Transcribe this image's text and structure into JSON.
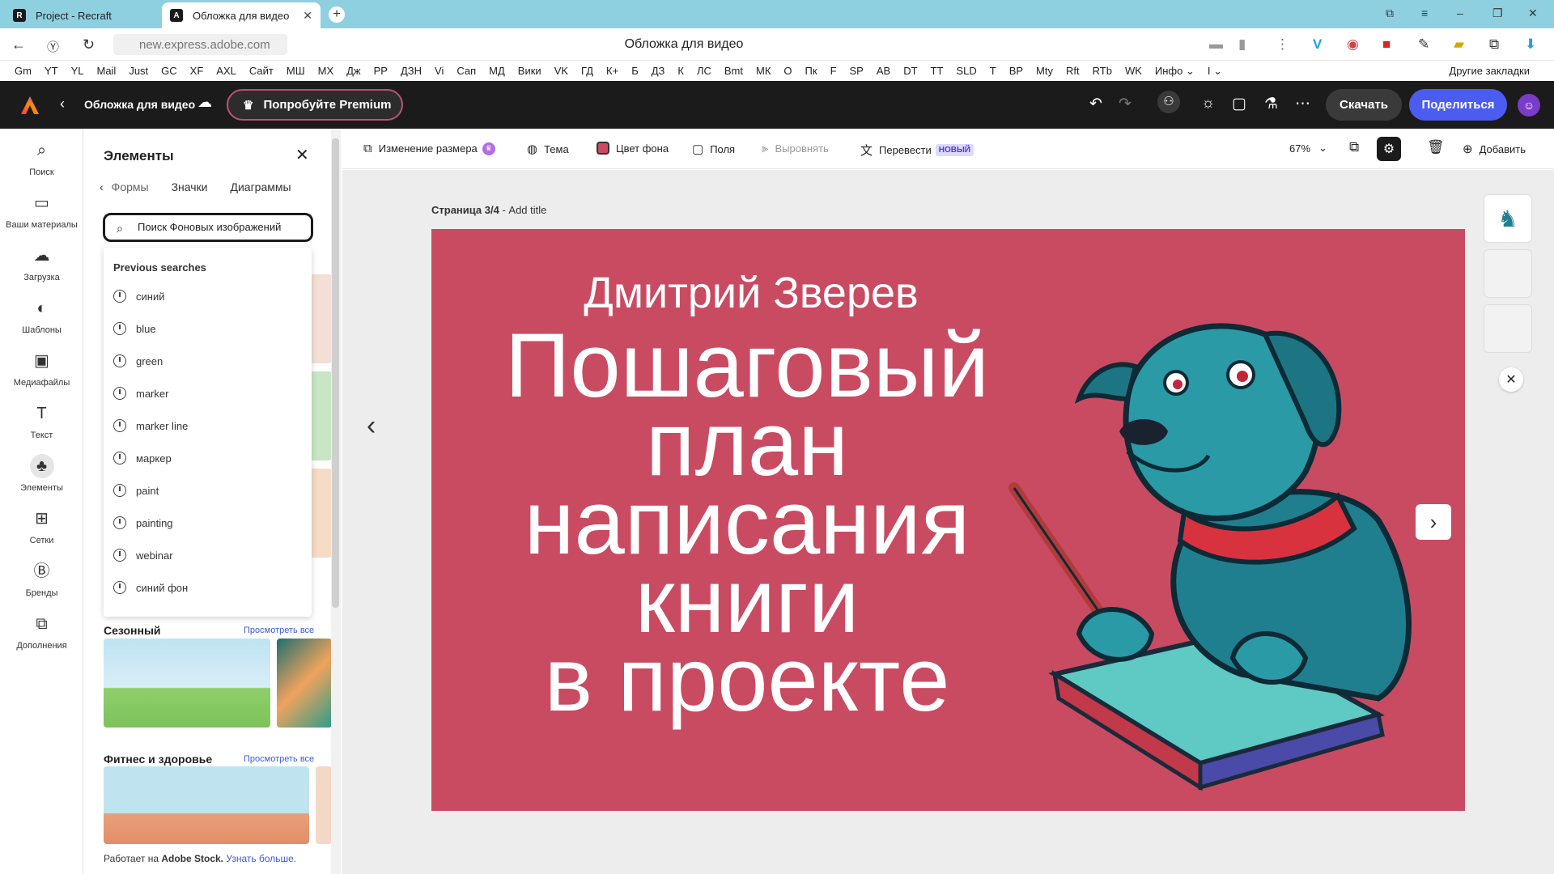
{
  "browser": {
    "tabs": [
      {
        "label": "Project - Recraft",
        "favicon": "R"
      },
      {
        "label": "Обложка для видео",
        "favicon": "A"
      }
    ],
    "url": "new.express.adobe.com",
    "page_title": "Обложка для видео",
    "bookmarks": [
      "Gm",
      "YT",
      "YL",
      "Mail",
      "Just",
      "GC",
      "XF",
      "AXL",
      "Сайт",
      "МШ",
      "МХ",
      "Дж",
      "РР",
      "ДЗН",
      "Vi",
      "Сап",
      "МД",
      "Вики",
      "VK",
      "ГД",
      "К+",
      "Б",
      "ДЗ",
      "К",
      "ЛС",
      "Bmt",
      "МК",
      "О",
      "Пк",
      "F",
      "SP",
      "АВ",
      "DT",
      "TT",
      "SLD",
      "T",
      "BP",
      "Mty",
      "Rft",
      "RTb",
      "WK",
      "Инфо ⌄",
      "I ⌄"
    ],
    "other_bookmarks": "Другие закладки"
  },
  "app": {
    "doc_title": "Обложка для видео",
    "premium_label": "Попробуйте Premium",
    "download_label": "Скачать",
    "share_label": "Поделиться"
  },
  "rail": [
    {
      "label": "Поиск",
      "icon": "search-icon",
      "glyph": "⌕"
    },
    {
      "label": "Ваши материалы",
      "icon": "folder-icon",
      "glyph": "▭"
    },
    {
      "label": "Загрузка",
      "icon": "upload-cloud-icon",
      "glyph": "☁"
    },
    {
      "label": "Шаблоны",
      "icon": "templates-icon",
      "glyph": "◐"
    },
    {
      "label": "Медиафайлы",
      "icon": "media-icon",
      "glyph": "▣"
    },
    {
      "label": "Текст",
      "icon": "text-icon",
      "glyph": "T"
    },
    {
      "label": "Элементы",
      "icon": "elements-icon",
      "glyph": "♣"
    },
    {
      "label": "Сетки",
      "icon": "grid-icon",
      "glyph": "⊞"
    },
    {
      "label": "Бренды",
      "icon": "brand-icon",
      "glyph": "Ⓑ"
    },
    {
      "label": "Дополнения",
      "icon": "addons-icon",
      "glyph": "⧉"
    }
  ],
  "panel": {
    "title": "Элементы",
    "tabs": [
      "Формы",
      "Значки",
      "Диаграммы"
    ],
    "search_value": "Поиск Фоновых изображений",
    "previous_searches_label": "Previous searches",
    "previous_searches": [
      "синий",
      "blue",
      "green",
      "marker",
      "marker line",
      "маркер",
      "paint",
      "painting",
      "webinar",
      "синий фон"
    ],
    "sections": [
      {
        "title": "Сезонный",
        "view_all": "Просмотреть все"
      },
      {
        "title": "Фитнес и здоровье",
        "view_all": "Просмотреть все"
      }
    ],
    "credit_prefix": "Работает на ",
    "credit_brand": "Adobe Stock.",
    "credit_link": "Узнать больше."
  },
  "toolbar": {
    "resize": "Изменение размера",
    "theme": "Тема",
    "bg_color": "Цвет фона",
    "margins": "Поля",
    "align": "Выровнять",
    "translate": "Перевести",
    "new_badge": "НОВЫЙ",
    "zoom": "67%",
    "add": "Добавить"
  },
  "canvas": {
    "page_label": "Страница 3/4",
    "page_title_placeholder": " - Add title",
    "slide_bg": "#c94b62",
    "author": "Дмитрий Зверев",
    "headline_lines": [
      "Пошаговый",
      "план",
      "написания",
      "книги",
      "в проекте"
    ]
  }
}
